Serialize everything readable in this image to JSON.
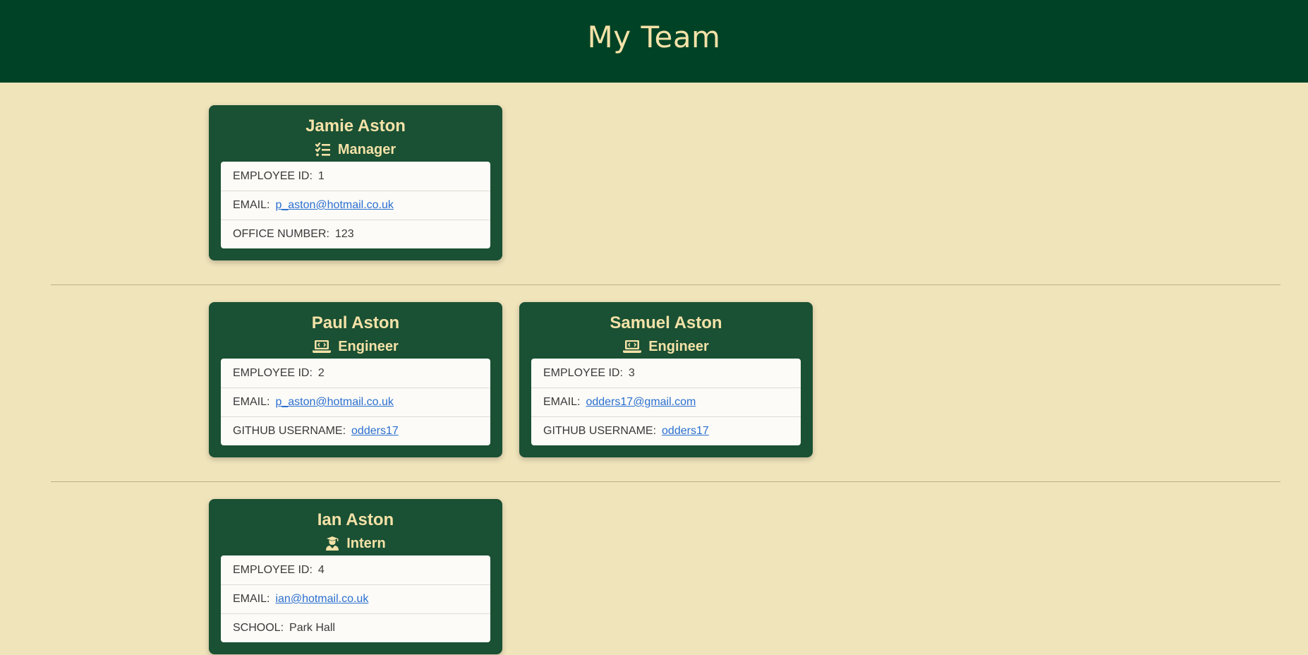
{
  "header": {
    "title": "My Team"
  },
  "manager": {
    "name": "Jamie Aston",
    "role": "Manager",
    "role_icon": "tasks-list-icon",
    "id_label": "EMPLOYEE ID:",
    "id_value": "1",
    "email_label": "EMAIL:",
    "email_value": "p_aston@hotmail.co.uk",
    "extra_label": "OFFICE NUMBER:",
    "extra_value": "123"
  },
  "engineers": [
    {
      "name": "Paul Aston",
      "role": "Engineer",
      "role_icon": "laptop-code-icon",
      "id_label": "EMPLOYEE ID:",
      "id_value": "2",
      "email_label": "EMAIL:",
      "email_value": "p_aston@hotmail.co.uk",
      "extra_label": "GITHUB USERNAME:",
      "extra_value": "odders17"
    },
    {
      "name": "Samuel Aston",
      "role": "Engineer",
      "role_icon": "laptop-code-icon",
      "id_label": "EMPLOYEE ID:",
      "id_value": "3",
      "email_label": "EMAIL:",
      "email_value": "odders17@gmail.com",
      "extra_label": "GITHUB USERNAME:",
      "extra_value": "odders17"
    }
  ],
  "interns": [
    {
      "name": "Ian Aston",
      "role": "Intern",
      "role_icon": "graduate-icon",
      "id_label": "EMPLOYEE ID:",
      "id_value": "4",
      "email_label": "EMAIL:",
      "email_value": "ian@hotmail.co.uk",
      "extra_label": "SCHOOL:",
      "extra_value": "Park Hall"
    }
  ],
  "colors": {
    "header_bg": "#004225",
    "page_bg": "#f0e4bb",
    "card_bg": "#1a5033",
    "accent_text": "#f4e2a8",
    "link": "#2b6fd0"
  }
}
